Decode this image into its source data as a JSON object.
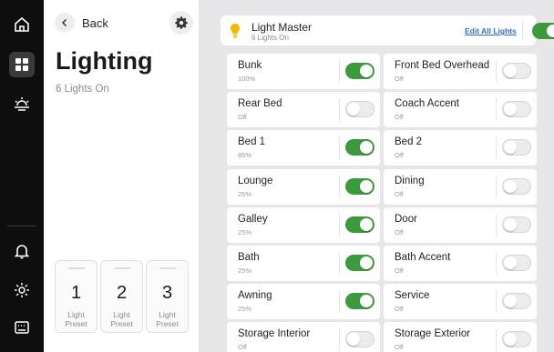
{
  "rail": {
    "icons": [
      "home-icon",
      "grid-icon",
      "climate-icon",
      "bell-icon",
      "settings-icon",
      "display-icon"
    ],
    "active": "grid-icon"
  },
  "panel": {
    "back_label": "Back",
    "title": "Lighting",
    "subtitle": "6 Lights On",
    "presets": [
      {
        "number": "1",
        "label_line1": "Light",
        "label_line2": "Preset"
      },
      {
        "number": "2",
        "label_line1": "Light",
        "label_line2": "Preset"
      },
      {
        "number": "3",
        "label_line1": "Light",
        "label_line2": "Preset"
      }
    ]
  },
  "master": {
    "title": "Light Master",
    "subtitle": "6 Lights On",
    "edit_label": "Edit All Lights",
    "on": true
  },
  "lights": [
    {
      "name": "Bunk",
      "status": "100%",
      "on": true
    },
    {
      "name": "Front Bed Overhead",
      "status": "Off",
      "on": false
    },
    {
      "name": "Rear Bed",
      "status": "Off",
      "on": false
    },
    {
      "name": "Coach Accent",
      "status": "Off",
      "on": false
    },
    {
      "name": "Bed 1",
      "status": "85%",
      "on": true
    },
    {
      "name": "Bed 2",
      "status": "Off",
      "on": false
    },
    {
      "name": "Lounge",
      "status": "25%",
      "on": true
    },
    {
      "name": "Dining",
      "status": "Off",
      "on": false
    },
    {
      "name": "Galley",
      "status": "25%",
      "on": true
    },
    {
      "name": "Door",
      "status": "Off",
      "on": false
    },
    {
      "name": "Bath",
      "status": "25%",
      "on": true
    },
    {
      "name": "Bath Accent",
      "status": "Off",
      "on": false
    },
    {
      "name": "Awning",
      "status": "25%",
      "on": true
    },
    {
      "name": "Service",
      "status": "Off",
      "on": false
    },
    {
      "name": "Storage Interior",
      "status": "Off",
      "on": false
    },
    {
      "name": "Storage Exterior",
      "status": "Off",
      "on": false
    }
  ],
  "colors": {
    "toggle_on": "#3c9a3c",
    "toggle_off": "#ececec",
    "accent_link": "#2f6ec8",
    "bulb": "#f5b800",
    "rail_bg": "#0e0e0e",
    "content_bg": "#e7e7ea"
  }
}
